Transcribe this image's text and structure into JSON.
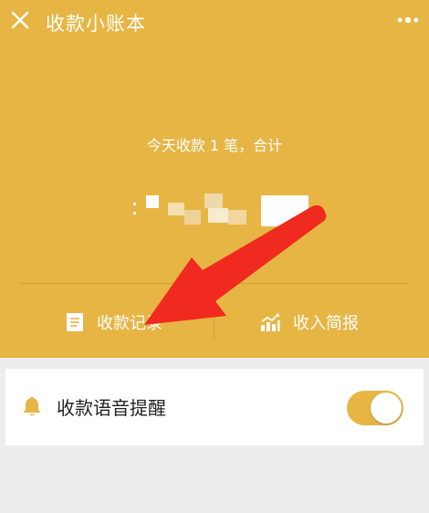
{
  "header": {
    "title": "收款小账本",
    "close_icon": "close-icon",
    "more_icon": "more-icon"
  },
  "summary": {
    "text": "今天收款 1 笔，合计"
  },
  "actions": {
    "records_label": "收款记录",
    "records_icon": "document-icon",
    "report_label": "收入简报",
    "report_icon": "chart-icon"
  },
  "voice_alert": {
    "label": "收款语音提醒",
    "icon": "bell-icon",
    "enabled": true
  },
  "colors": {
    "accent": "#e6b544",
    "annotation_arrow": "#f02a1e"
  }
}
